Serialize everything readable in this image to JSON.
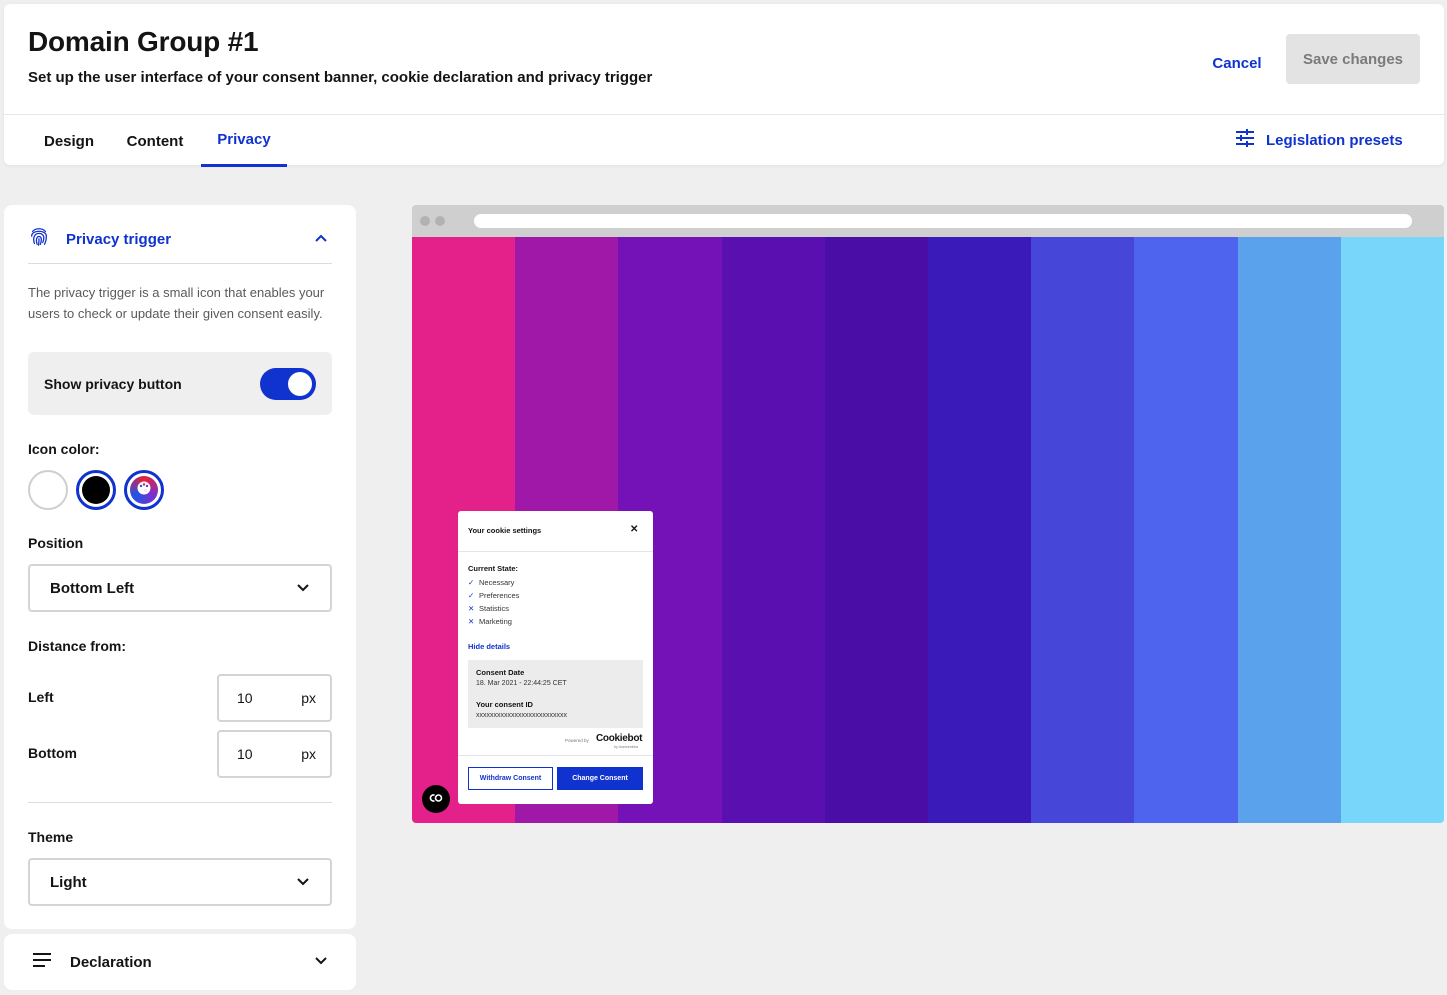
{
  "header": {
    "title": "Domain Group #1",
    "subtitle": "Set up the user interface of your consent banner, cookie declaration and privacy trigger",
    "cancel_label": "Cancel",
    "save_label": "Save changes"
  },
  "tabs": [
    {
      "label": "Design"
    },
    {
      "label": "Content"
    },
    {
      "label": "Privacy",
      "active": true
    }
  ],
  "legislation_presets": "Legislation presets",
  "privacy_trigger": {
    "title": "Privacy trigger",
    "description": "The privacy trigger is a small icon that enables your users to check or update their given consent easily.",
    "show_button_label": "Show privacy button",
    "show_button_on": true,
    "icon_color_label": "Icon color:",
    "icon_colors": [
      "#ffffff",
      "#000000",
      "custom"
    ],
    "selected_icon_color": "#000000",
    "position_label": "Position",
    "position_value": "Bottom Left",
    "distance_label": "Distance from:",
    "left_label": "Left",
    "left_value": "10",
    "bottom_label": "Bottom",
    "bottom_value": "10",
    "unit": "px",
    "theme_label": "Theme",
    "theme_value": "Light"
  },
  "declaration": {
    "title": "Declaration"
  },
  "preview": {
    "stripe_colors": [
      "#e4218a",
      "#a018a8",
      "#7412b8",
      "#5a0fb0",
      "#4a0ea6",
      "#3a1ab8",
      "#4646d8",
      "#4f64ee",
      "#5aa2ec",
      "#78d6fa"
    ],
    "dialog": {
      "title": "Your cookie settings",
      "current_state": "Current State:",
      "items": [
        {
          "label": "Necessary",
          "mark": "✓"
        },
        {
          "label": "Preferences",
          "mark": "✓"
        },
        {
          "label": "Statistics",
          "mark": "✕"
        },
        {
          "label": "Marketing",
          "mark": "✕"
        }
      ],
      "hide_details": "Hide details",
      "consent_date_label": "Consent Date",
      "consent_date_value": "18. Mar 2021 - 22:44:25 CET",
      "consent_id_label": "Your consent ID",
      "consent_id_value": "xxxxxxxxxxxxxxxxxxxxxxxxxx",
      "powered_by": "Powered by",
      "brand": "Cookiebot",
      "brand_sub": "by Usercentrics",
      "withdraw_label": "Withdraw Consent",
      "change_label": "Change Consent"
    }
  }
}
